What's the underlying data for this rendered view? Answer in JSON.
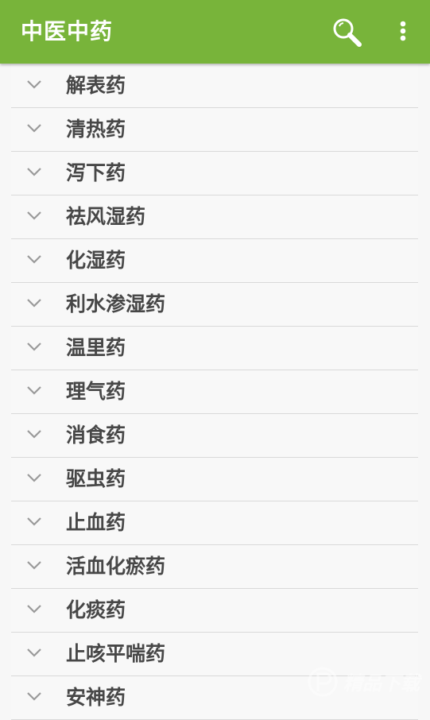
{
  "appbar": {
    "title": "中医中药",
    "color": "#78b43a",
    "search_icon": "search-icon",
    "more_icon": "more-vert-icon"
  },
  "categories": [
    {
      "label": "解表药"
    },
    {
      "label": "清热药"
    },
    {
      "label": "泻下药"
    },
    {
      "label": "祛风湿药"
    },
    {
      "label": "化湿药"
    },
    {
      "label": "利水渗湿药"
    },
    {
      "label": "温里药"
    },
    {
      "label": "理气药"
    },
    {
      "label": "消食药"
    },
    {
      "label": "驱虫药"
    },
    {
      "label": "止血药"
    },
    {
      "label": "活血化瘀药"
    },
    {
      "label": "化痰药"
    },
    {
      "label": "止咳平喘药"
    },
    {
      "label": "安神药"
    }
  ],
  "row_icon": "chevron-down-icon",
  "watermark": {
    "text": "精品下载",
    "logo_icon": "watermark-logo"
  }
}
